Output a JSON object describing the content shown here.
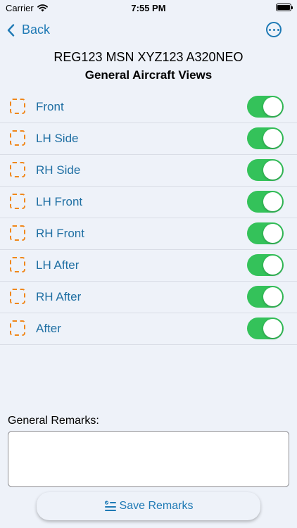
{
  "status_bar": {
    "carrier": "Carrier",
    "time": "7:55 PM"
  },
  "nav": {
    "back_label": "Back",
    "more_icon": "ellipsis-circle-icon"
  },
  "header": {
    "aircraft": "REG123 MSN XYZ123 A320NEO",
    "title": "General Aircraft Views"
  },
  "views": [
    {
      "label": "Front",
      "checked": false,
      "enabled": true
    },
    {
      "label": "LH Side",
      "checked": false,
      "enabled": true
    },
    {
      "label": "RH Side",
      "checked": false,
      "enabled": true
    },
    {
      "label": "LH Front",
      "checked": false,
      "enabled": true
    },
    {
      "label": "RH Front",
      "checked": false,
      "enabled": true
    },
    {
      "label": "LH After",
      "checked": false,
      "enabled": true
    },
    {
      "label": "RH After",
      "checked": false,
      "enabled": true
    },
    {
      "label": "After",
      "checked": false,
      "enabled": true
    }
  ],
  "remarks": {
    "label": "General Remarks:",
    "value": ""
  },
  "save_button": {
    "label": "Save Remarks",
    "icon": "checklist-icon"
  },
  "colors": {
    "accent": "#1f7ab5",
    "toggle_on": "#34c25a",
    "checkbox": "#f0871a",
    "background": "#eef2f9"
  }
}
